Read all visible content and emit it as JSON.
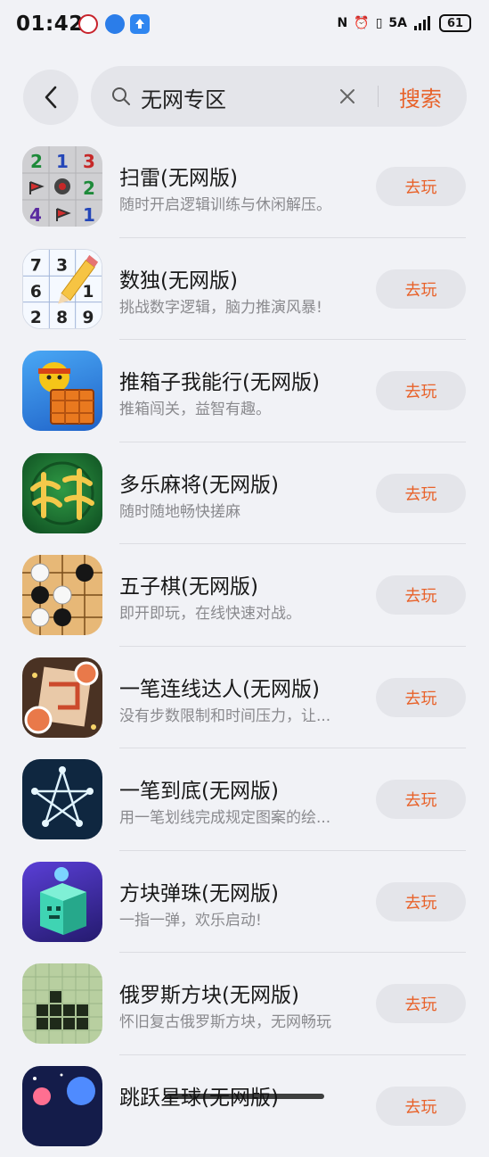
{
  "status": {
    "time": "01:42",
    "network": "5A",
    "battery": "61"
  },
  "search": {
    "query": "无网专区",
    "button": "搜索"
  },
  "apps": [
    {
      "title": "扫雷(无网版)",
      "desc": "随时开启逻辑训练与休闲解压。",
      "action": "去玩",
      "icon": "minesweeper-icon"
    },
    {
      "title": "数独(无网版)",
      "desc": "挑战数字逻辑，脑力推演风暴!",
      "action": "去玩",
      "icon": "sudoku-icon"
    },
    {
      "title": "推箱子我能行(无网版)",
      "desc": "推箱闯关，益智有趣。",
      "action": "去玩",
      "icon": "sokoban-icon"
    },
    {
      "title": "多乐麻将(无网版)",
      "desc": "随时随地畅快搓麻",
      "action": "去玩",
      "icon": "mahjong-icon"
    },
    {
      "title": "五子棋(无网版)",
      "desc": "即开即玩，在线快速对战。",
      "action": "去玩",
      "icon": "gomoku-icon"
    },
    {
      "title": "一笔连线达人(无网版)",
      "desc": "没有步数限制和时间压力，让...",
      "action": "去玩",
      "icon": "line-connect-icon"
    },
    {
      "title": "一笔到底(无网版)",
      "desc": "用一笔划线完成规定图案的绘...",
      "action": "去玩",
      "icon": "one-stroke-icon"
    },
    {
      "title": "方块弹珠(无网版)",
      "desc": "一指一弹，欢乐启动!",
      "action": "去玩",
      "icon": "block-ball-icon"
    },
    {
      "title": "俄罗斯方块(无网版)",
      "desc": "怀旧复古俄罗斯方块，无网畅玩",
      "action": "去玩",
      "icon": "tetris-icon"
    },
    {
      "title": "跳跃星球(无网版)",
      "desc": "",
      "action": "去玩",
      "icon": "jump-planet-icon"
    }
  ],
  "colors": {
    "accent": "#e8622a",
    "background": "#f1f2f6",
    "pill": "#e4e5ea"
  }
}
